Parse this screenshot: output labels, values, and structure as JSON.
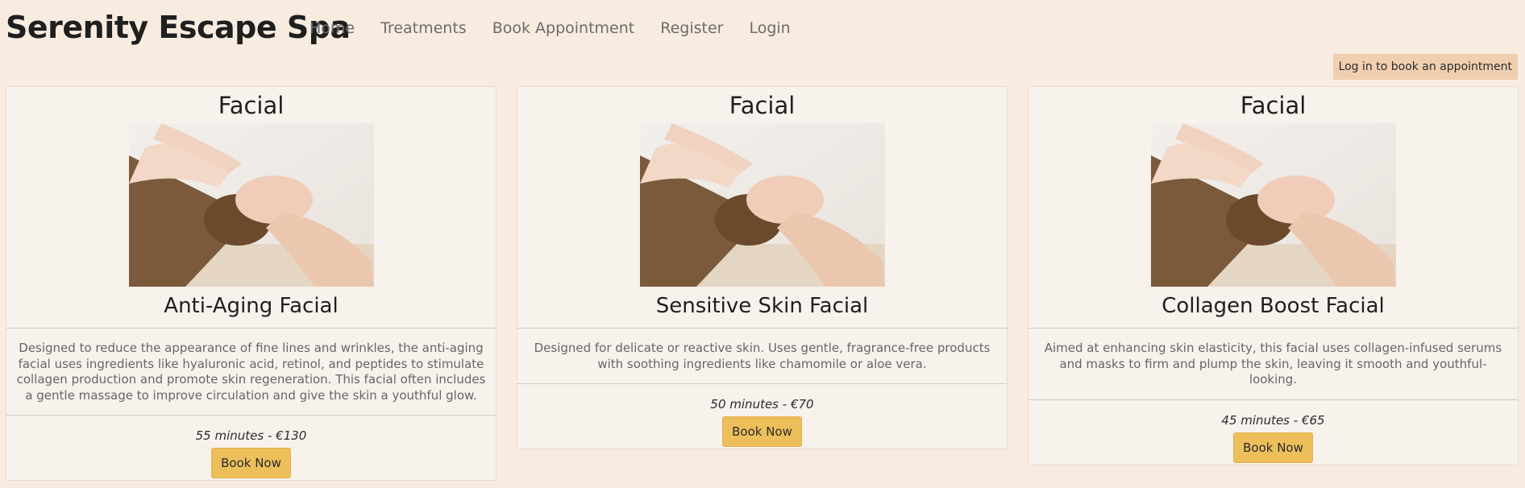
{
  "brand": "Serenity Escape Spa",
  "nav": [
    {
      "label": "Home"
    },
    {
      "label": "Treatments"
    },
    {
      "label": "Book Appointment"
    },
    {
      "label": "Register"
    },
    {
      "label": "Login"
    }
  ],
  "login_note": "Log in to book an appointment",
  "cards": [
    {
      "category": "Facial",
      "name": "Anti-Aging Facial",
      "description": "Designed to reduce the appearance of fine lines and wrinkles, the anti-aging facial uses ingredients like hyaluronic acid, retinol, and peptides to stimulate collagen production and promote skin regeneration. This facial often includes a gentle massage to improve circulation and give the skin a youthful glow.",
      "meta": "55 minutes - €130",
      "button": "Book Now"
    },
    {
      "category": "Facial",
      "name": "Sensitive Skin Facial",
      "description": "Designed for delicate or reactive skin. Uses gentle, fragrance-free products with soothing ingredients like chamomile or aloe vera.",
      "meta": "50 minutes - €70",
      "button": "Book Now"
    },
    {
      "category": "Facial",
      "name": "Collagen Boost Facial",
      "description": "Aimed at enhancing skin elasticity, this facial uses collagen-infused serums and masks to firm and plump the skin, leaving it smooth and youthful-looking.",
      "meta": "45 minutes - €65",
      "button": "Book Now"
    }
  ],
  "colors": {
    "background": "#f8ece0",
    "card": "#f8f2ed",
    "button": "#ecbf5b",
    "login_note": "#f0cfb0"
  }
}
